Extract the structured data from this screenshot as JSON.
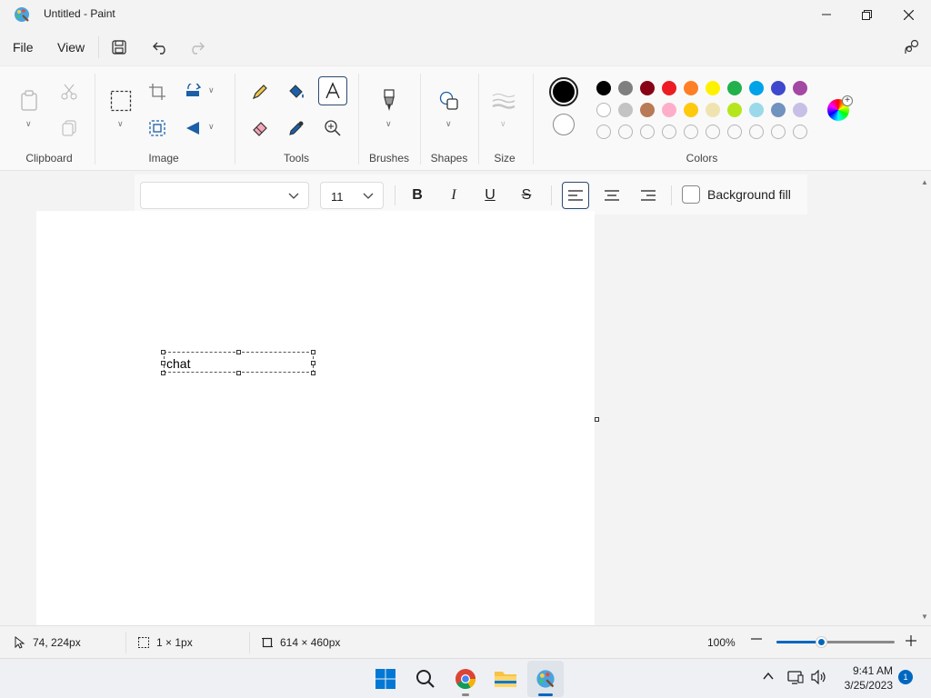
{
  "window": {
    "title": "Untitled - Paint",
    "app_icon": "paint-palette-icon",
    "controls": [
      "minimize-icon",
      "maximize-icon",
      "close-icon"
    ]
  },
  "menu": {
    "file": "File",
    "view": "View",
    "icons": [
      "save-icon",
      "undo-icon",
      "redo-icon",
      "share-icon"
    ]
  },
  "ribbon": {
    "groups": {
      "clipboard": "Clipboard",
      "image": "Image",
      "tools": "Tools",
      "brushes": "Brushes",
      "shapes": "Shapes",
      "size": "Size",
      "colors": "Colors"
    },
    "selected_tool": "text",
    "colors": {
      "primary": "#000000",
      "secondary": "#ffffff",
      "row1": [
        "#000000",
        "#7f7f7f",
        "#880015",
        "#ed1c24",
        "#ff7f27",
        "#fff200",
        "#22b14c",
        "#00a2e8",
        "#3f48cc",
        "#a349a4"
      ],
      "row2": [
        "#ffffff",
        "#c3c3c3",
        "#b97a57",
        "#ffaec9",
        "#ffc90e",
        "#efe4b0",
        "#b5e61d",
        "#99d9ea",
        "#7092be",
        "#c8bfe7"
      ],
      "row3_empty_count": 10
    }
  },
  "text_toolbar": {
    "font_name": "",
    "font_size": "11",
    "bold_label": "B",
    "italic_label": "I",
    "underline_label": "U",
    "strike_label": "S",
    "alignment": "left",
    "background_fill": "Background fill",
    "background_fill_checked": false
  },
  "canvas": {
    "text": "chat"
  },
  "status": {
    "cursor": "74, 224px",
    "selection": "1 × 1px",
    "canvas_size": "614 × 460px",
    "zoom": "100%",
    "zoom_fraction": 0.38
  },
  "taskbar": {
    "apps": [
      "windows-start-icon",
      "search-icon",
      "chrome-icon",
      "file-explorer-icon",
      "paint-icon"
    ],
    "time": "9:41 AM",
    "date": "3/25/2023",
    "notification_count": "1"
  }
}
